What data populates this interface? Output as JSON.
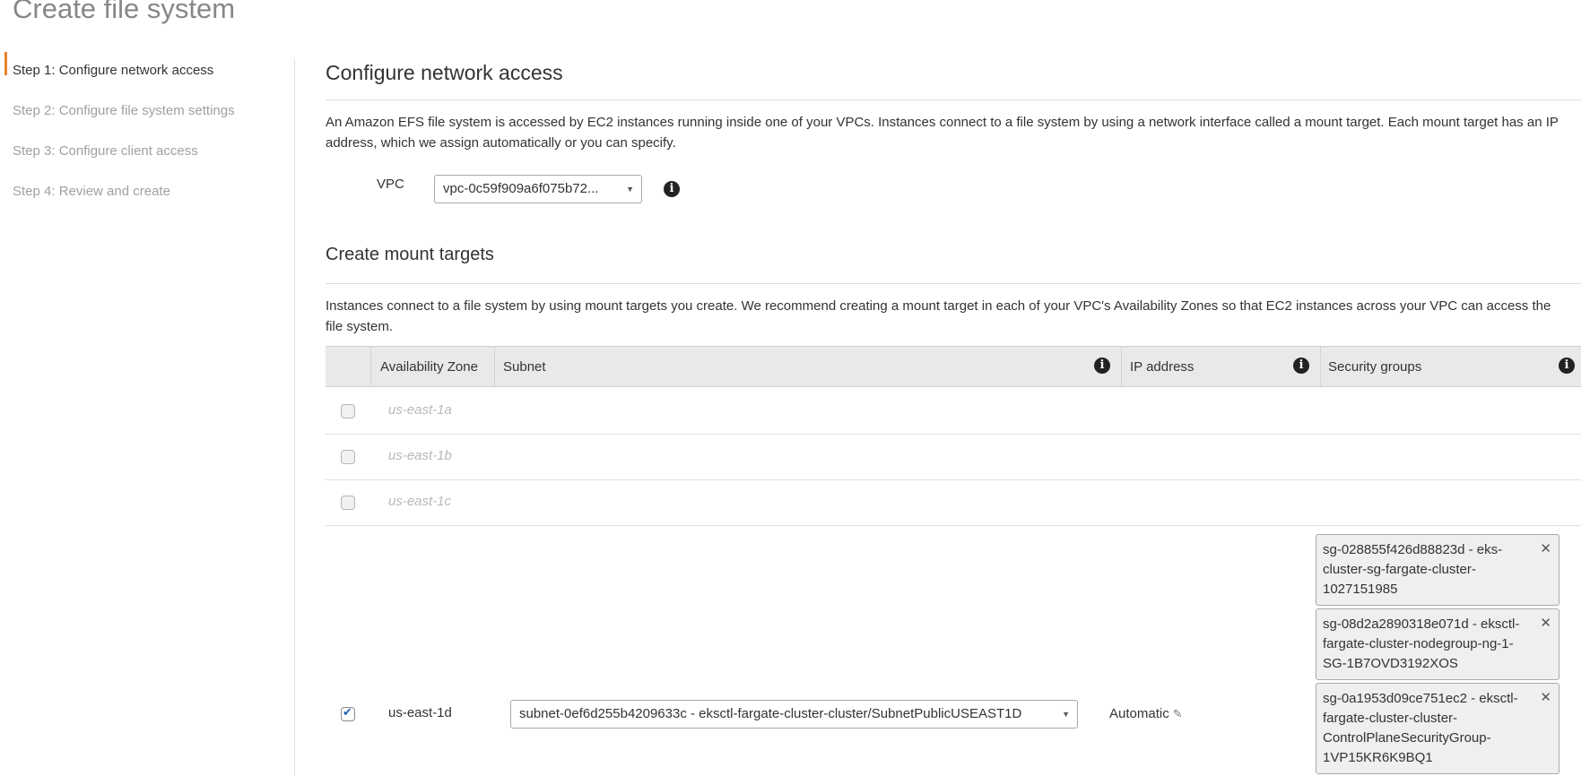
{
  "page": {
    "title": "Create file system"
  },
  "steps": [
    {
      "label": "Step 1: Configure network access",
      "active": true
    },
    {
      "label": "Step 2: Configure file system settings",
      "active": false
    },
    {
      "label": "Step 3: Configure client access",
      "active": false
    },
    {
      "label": "Step 4: Review and create",
      "active": false
    }
  ],
  "network": {
    "heading": "Configure network access",
    "description": "An Amazon EFS file system is accessed by EC2 instances running inside one of your VPCs. Instances connect to a file system by using a network interface called a mount target. Each mount target has an IP address, which we assign automatically or you can specify.",
    "vpc_label": "VPC",
    "vpc_value": "vpc-0c59f909a6f075b72..."
  },
  "mount_targets": {
    "heading": "Create mount targets",
    "description": "Instances connect to a file system by using mount targets you create. We recommend creating a mount target in each of your VPC's Availability Zones so that EC2 instances across your VPC can access the file system.",
    "columns": [
      "Availability Zone",
      "Subnet",
      "IP address",
      "Security groups"
    ],
    "rows": [
      {
        "az": "us-east-1a",
        "checked": false
      },
      {
        "az": "us-east-1b",
        "checked": false
      },
      {
        "az": "us-east-1c",
        "checked": false
      },
      {
        "az": "us-east-1d",
        "checked": true,
        "subnet": "subnet-0ef6d255b4209633c - eksctl-fargate-cluster-cluster/SubnetPublicUSEAST1D",
        "ip": "Automatic",
        "security_groups": [
          "sg-028855f426d88823d - eks-cluster-sg-fargate-cluster-1027151985",
          "sg-08d2a2890318e071d - eksctl-fargate-cluster-nodegroup-ng-1-SG-1B7OVD3192XOS",
          "sg-0a1953d09ce751ec2 - eksctl-fargate-cluster-cluster-ControlPlaneSecurityGroup-1VP15KR6K9BQ1"
        ]
      }
    ]
  },
  "icons": {
    "info": "info-icon",
    "close": "close-icon",
    "edit": "pencil-icon",
    "caret": "caret-down-icon"
  },
  "colors": {
    "accent": "#e7832b",
    "header_bg": "#e9e9e9"
  }
}
